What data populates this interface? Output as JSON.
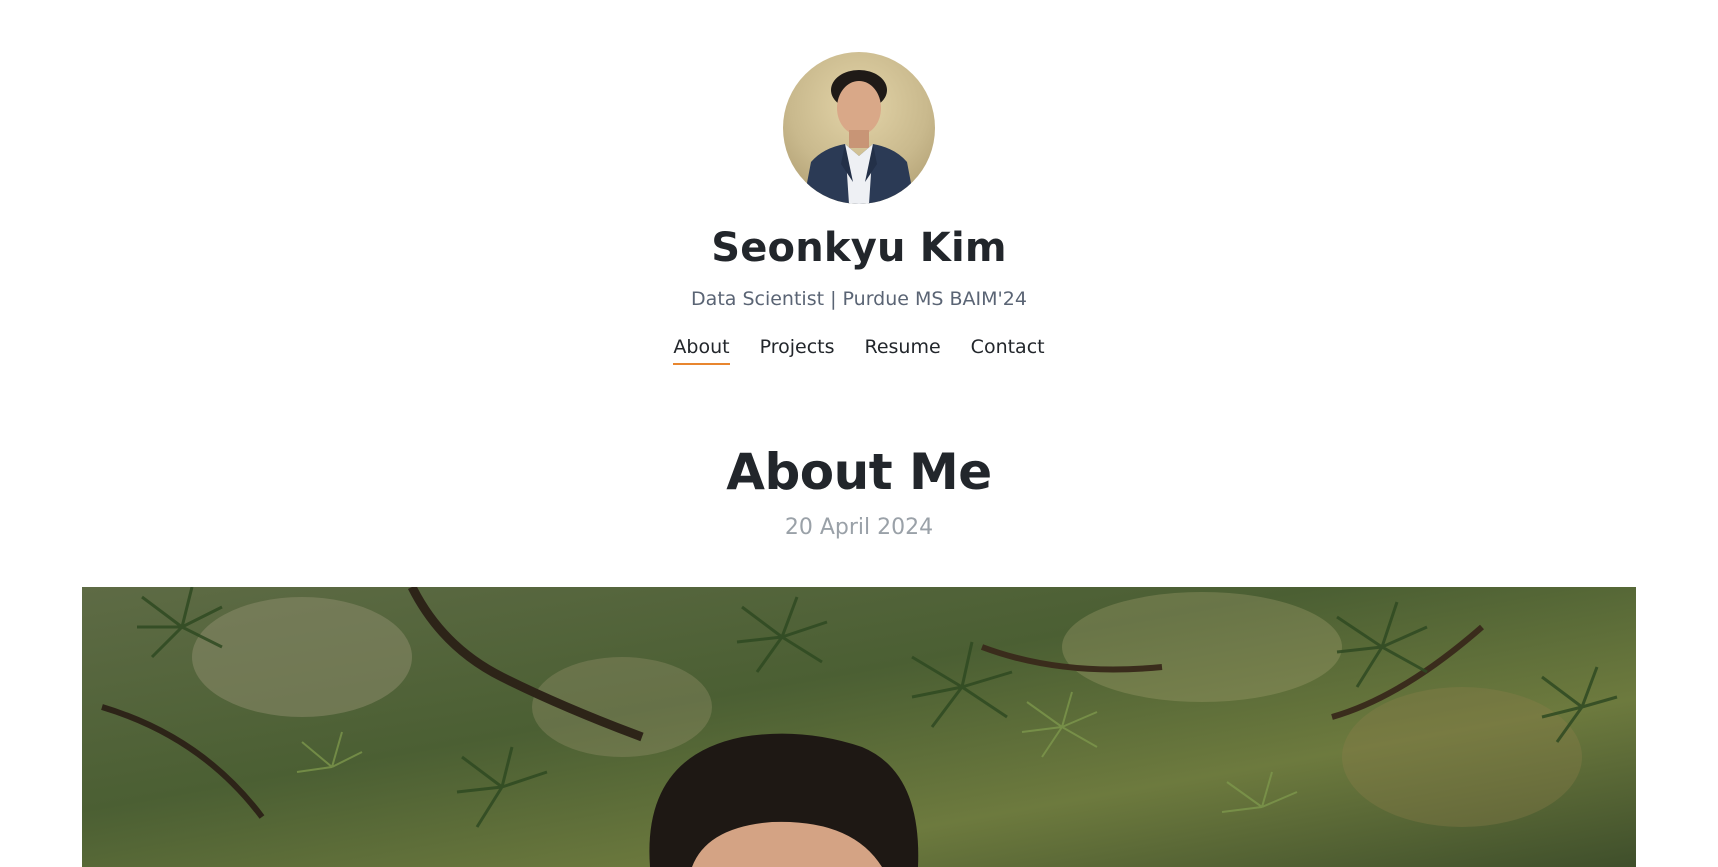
{
  "header": {
    "avatar_icon": "profile-portrait",
    "site_title": "Seonkyu Kim",
    "tagline": "Data Scientist | Purdue MS BAIM'24"
  },
  "nav": {
    "items": [
      {
        "label": "About",
        "active": true
      },
      {
        "label": "Projects",
        "active": false
      },
      {
        "label": "Resume",
        "active": false
      },
      {
        "label": "Contact",
        "active": false
      }
    ],
    "accent_color": "#e8862f"
  },
  "main": {
    "title": "About Me",
    "date": "20 April 2024",
    "hero_image_icon": "portrait-photo-pine-trees"
  }
}
